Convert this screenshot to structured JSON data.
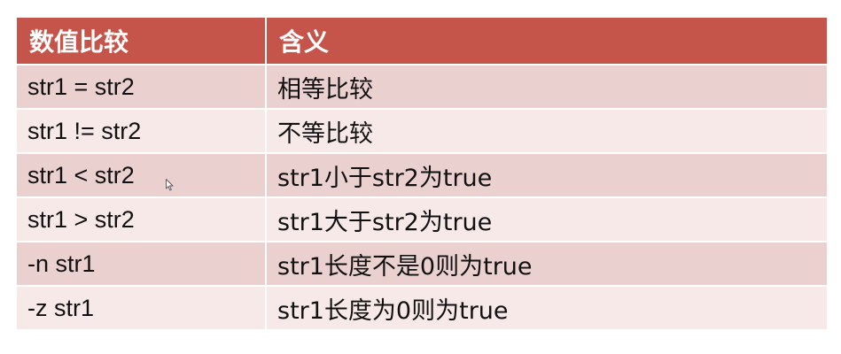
{
  "table": {
    "headers": [
      "数值比较",
      "含义"
    ],
    "rows": [
      {
        "op": "str1 = str2",
        "meaning": "相等比较"
      },
      {
        "op": "str1 != str2",
        "meaning": "不等比较"
      },
      {
        "op": "str1 < str2",
        "meaning": "str1小于str2为true"
      },
      {
        "op": "str1 > str2",
        "meaning": "str1大于str2为true"
      },
      {
        "op": "-n str1",
        "meaning": "str1长度不是0则为true"
      },
      {
        "op": "-z str1",
        "meaning": "str1长度为0则为true"
      }
    ]
  },
  "colors": {
    "header_bg": "#c5554b",
    "row_odd_bg": "#ead0cf",
    "row_even_bg": "#f6e9e8"
  },
  "cursor_icon": "mouse-pointer-icon"
}
